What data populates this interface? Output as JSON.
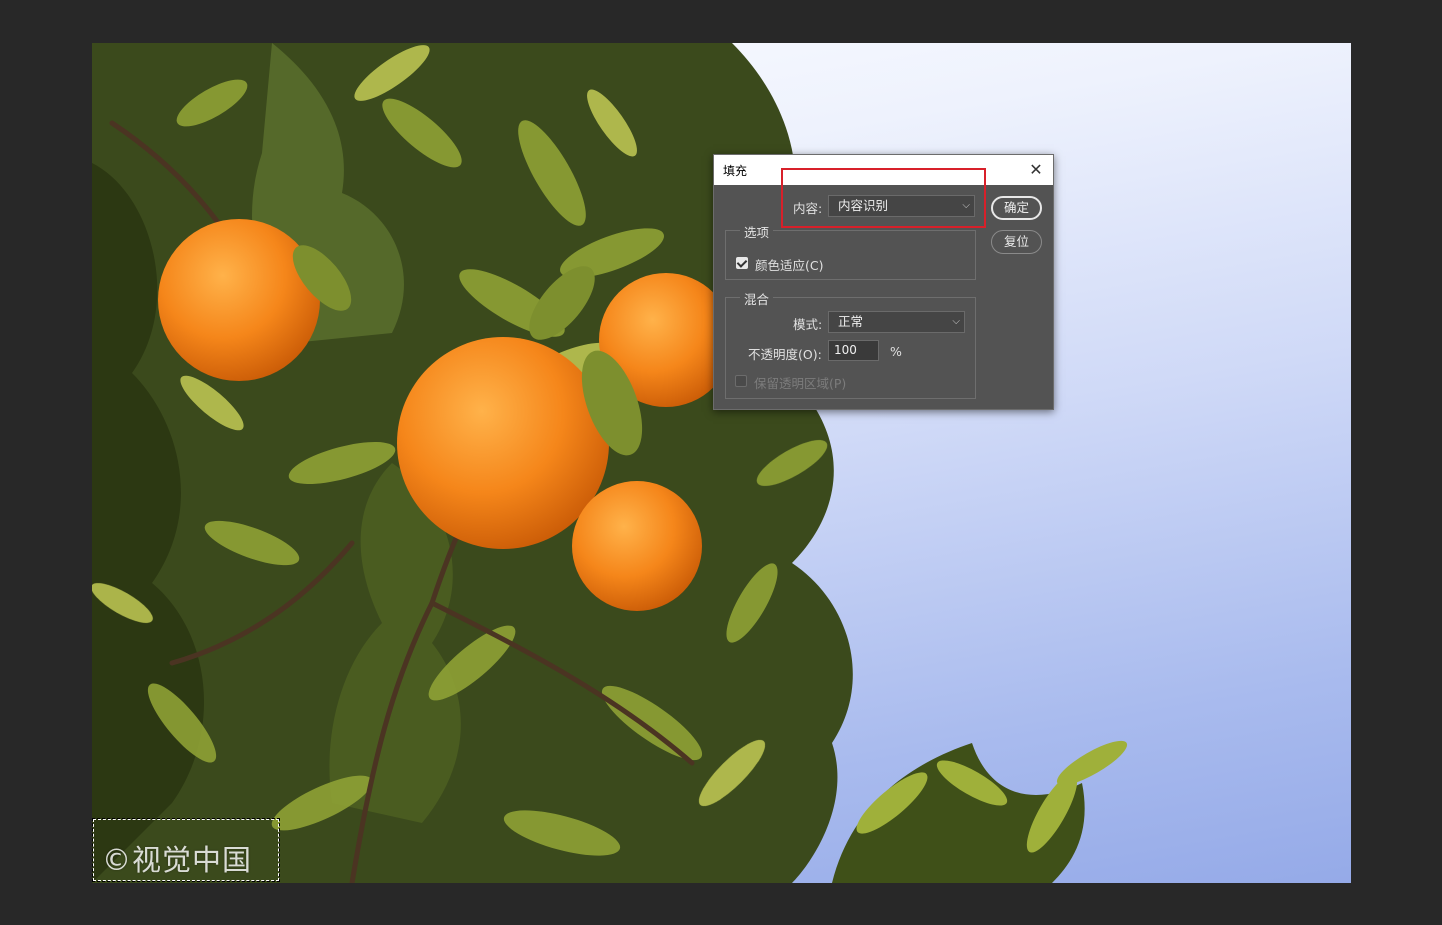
{
  "watermark": "©视觉中国",
  "dialog": {
    "title": "填充",
    "close_icon": "close-icon",
    "content_label": "内容:",
    "content_value": "内容识别",
    "ok_label": "确定",
    "reset_label": "复位",
    "options": {
      "group_title": "选项",
      "color_adapt_label": "颜色适应(C)",
      "color_adapt_checked": true
    },
    "blend": {
      "group_title": "混合",
      "mode_label": "模式:",
      "mode_value": "正常",
      "opacity_label": "不透明度(O):",
      "opacity_value": "100",
      "opacity_unit": "%",
      "preserve_label": "保留透明区域(P)",
      "preserve_checked": false,
      "preserve_enabled": false
    }
  },
  "colors": {
    "workspace_bg": "#282828",
    "dialog_bg": "#535353",
    "highlight_box": "#d8202a"
  }
}
